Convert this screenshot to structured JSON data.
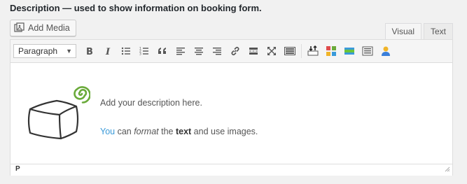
{
  "label": "Description — used to show information on booking form.",
  "add_media": {
    "label": "Add Media",
    "icon": "add-media-icon"
  },
  "tabs": [
    {
      "label": "Visual",
      "active": true
    },
    {
      "label": "Text",
      "active": false
    }
  ],
  "toolbar": {
    "format_value": "Paragraph",
    "buttons": [
      "bold-icon",
      "italic-icon",
      "bullet-list-icon",
      "numbered-list-icon",
      "blockquote-icon",
      "align-left-icon",
      "align-center-icon",
      "align-right-icon",
      "link-icon",
      "read-more-icon",
      "fullscreen-icon",
      "toolbar-toggle-icon",
      "insert-icon",
      "grid-icon",
      "green-bar-icon",
      "list-box-icon",
      "person-icon"
    ]
  },
  "content": {
    "line1": "Add your description here.",
    "line2_parts": {
      "you": "You",
      "can": " can ",
      "format": "format",
      "the": " the ",
      "text": "text",
      "rest": " and use images."
    }
  },
  "status": {
    "path": "P"
  },
  "colors": {
    "accent_blue": "#3a9ad9",
    "spiral_green": "#6aaa3a"
  }
}
